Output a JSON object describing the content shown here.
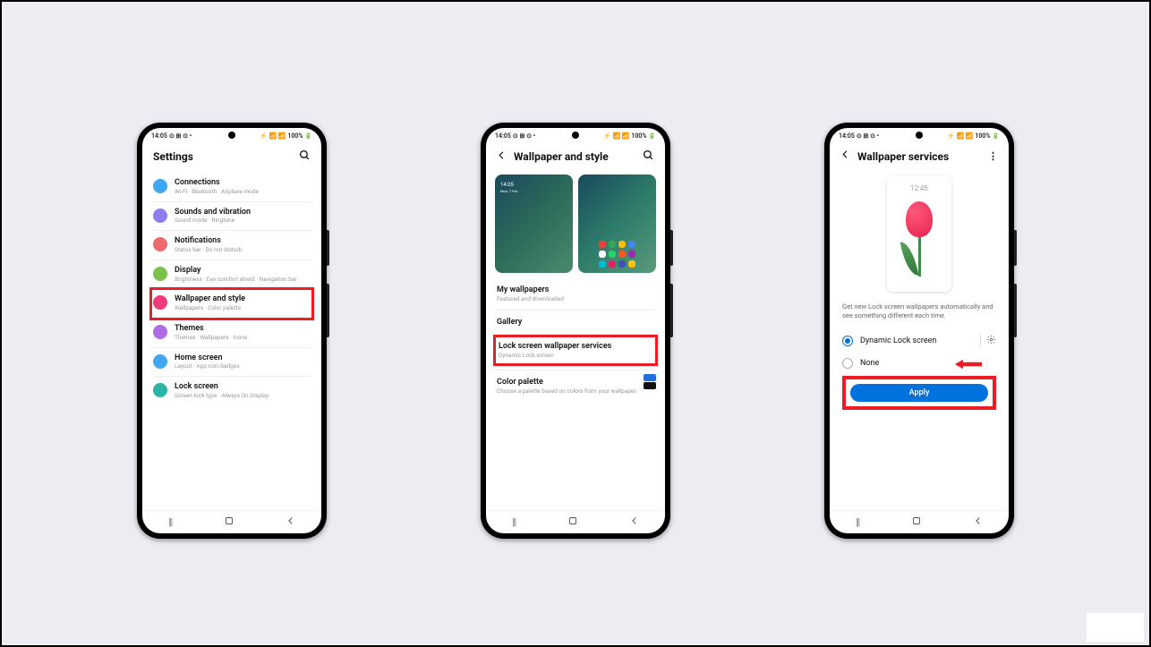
{
  "statusbar": {
    "time": "14:05",
    "indicators": "⊙ ⊞ ⊙ •",
    "battery": "⚡ 📶 📶 100% 🔋"
  },
  "phone1": {
    "title": "Settings",
    "items": [
      {
        "icon_color": "#3ea7f0",
        "title": "Connections",
        "subtitle": "Wi-Fi · Bluetooth · Airplane mode"
      },
      {
        "icon_color": "#8e7cf0",
        "title": "Sounds and vibration",
        "subtitle": "Sound mode · Ringtone"
      },
      {
        "icon_color": "#ef6b6b",
        "title": "Notifications",
        "subtitle": "Status bar · Do not disturb"
      },
      {
        "icon_color": "#7cc24a",
        "title": "Display",
        "subtitle": "Brightness · Eye comfort shield · Navigation bar"
      },
      {
        "icon_color": "#ef3b7a",
        "title": "Wallpaper and style",
        "subtitle": "Wallpapers · Color palette",
        "highlight": true
      },
      {
        "icon_color": "#b06be8",
        "title": "Themes",
        "subtitle": "Themes · Wallpapers · Icons"
      },
      {
        "icon_color": "#3ea7f0",
        "title": "Home screen",
        "subtitle": "Layout · App icon badges"
      },
      {
        "icon_color": "#2bb5a8",
        "title": "Lock screen",
        "subtitle": "Screen lock type · Always On Display"
      }
    ]
  },
  "phone2": {
    "title": "Wallpaper and style",
    "my_wallpapers": {
      "title": "My wallpapers",
      "subtitle": "Featured and downloaded"
    },
    "gallery": {
      "title": "Gallery"
    },
    "lock_services": {
      "title": "Lock screen wallpaper services",
      "subtitle": "Dynamic Lock screen"
    },
    "color_palette": {
      "title": "Color palette",
      "subtitle": "Choose a palette based on colors from your wallpaper."
    },
    "swatches": [
      "#1e6fe0",
      "#111111"
    ]
  },
  "phone3": {
    "title": "Wallpaper services",
    "preview_clock": "12:45",
    "description": "Get new Lock screen wallpapers automatically and see something different each time.",
    "options": [
      {
        "label": "Dynamic Lock screen",
        "checked": true,
        "has_settings": true
      },
      {
        "label": "None",
        "checked": false,
        "arrow": true
      }
    ],
    "apply_label": "Apply"
  },
  "nav": {
    "recents": "|||",
    "home": "○",
    "back": "⟨"
  }
}
